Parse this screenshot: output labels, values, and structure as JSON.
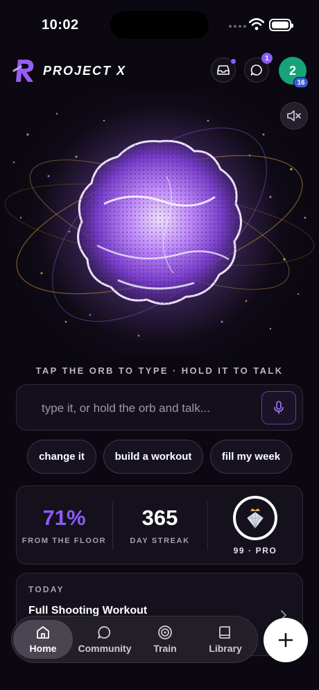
{
  "status": {
    "time": "10:02"
  },
  "header": {
    "brand": "PROJECT X",
    "chat_count": "1",
    "avatar_level": "2",
    "avatar_badge": "16"
  },
  "hint": "TAP THE ORB TO TYPE · HOLD IT TO TALK",
  "composer": {
    "placeholder": "type it, or hold the orb and talk..."
  },
  "chips": [
    "change it",
    "build a workout",
    "fill my week"
  ],
  "stats": {
    "floor_pct": "71%",
    "floor_label": "FROM THE FLOOR",
    "streak": "365",
    "streak_label": "DAY STREAK",
    "rank_label": "99 · PRO"
  },
  "today": {
    "label": "TODAY",
    "title": "Full Shooting Workout"
  },
  "tabs": [
    {
      "label": "Home",
      "icon": "home-icon"
    },
    {
      "label": "Community",
      "icon": "chat-bubble-icon"
    },
    {
      "label": "Train",
      "icon": "target-icon"
    },
    {
      "label": "Library",
      "icon": "book-icon"
    }
  ],
  "colors": {
    "accent": "#8b5cf6",
    "avatar": "#17a37a",
    "background": "#0b0811"
  }
}
